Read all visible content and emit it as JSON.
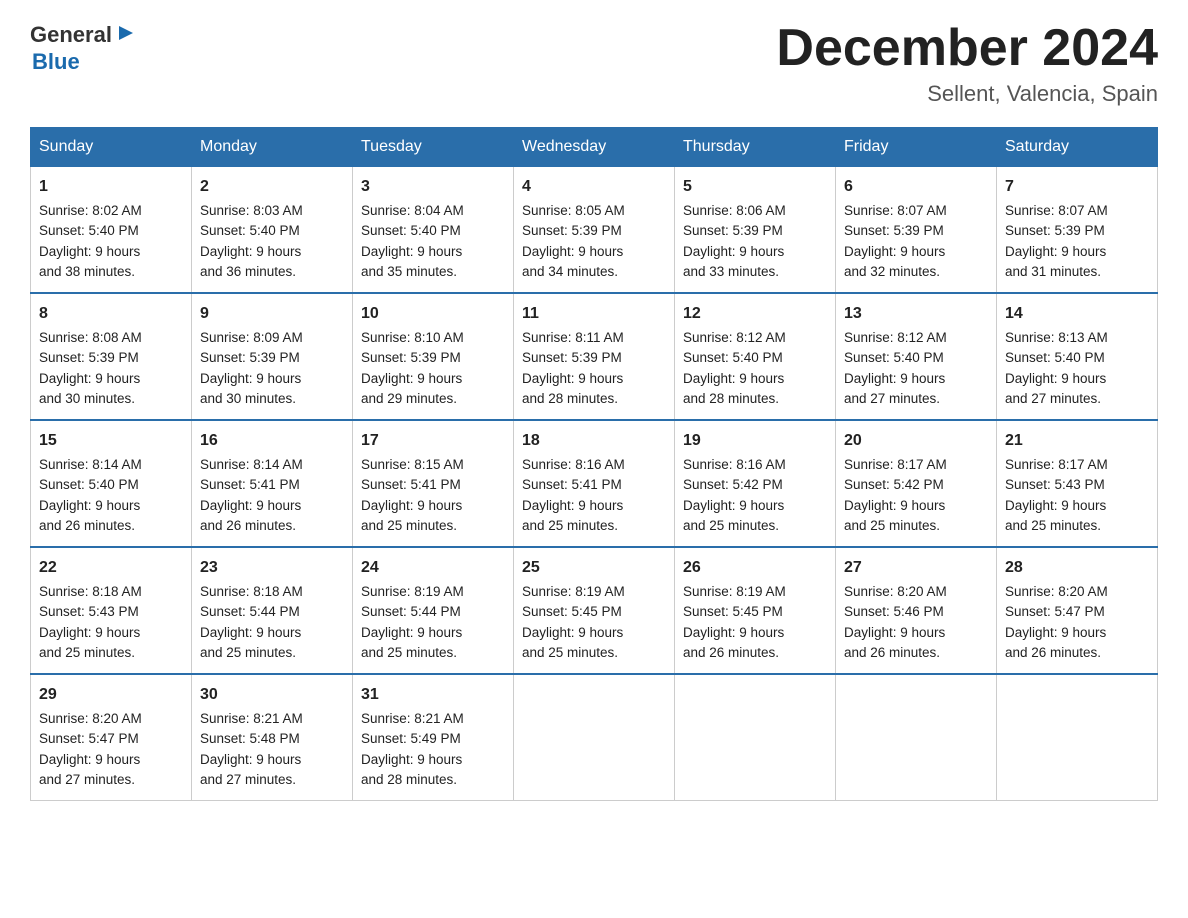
{
  "logo": {
    "text_general": "General",
    "text_blue": "Blue"
  },
  "title": "December 2024",
  "location": "Sellent, Valencia, Spain",
  "days_of_week": [
    "Sunday",
    "Monday",
    "Tuesday",
    "Wednesday",
    "Thursday",
    "Friday",
    "Saturday"
  ],
  "weeks": [
    [
      {
        "day": "1",
        "sunrise": "8:02 AM",
        "sunset": "5:40 PM",
        "daylight": "9 hours and 38 minutes."
      },
      {
        "day": "2",
        "sunrise": "8:03 AM",
        "sunset": "5:40 PM",
        "daylight": "9 hours and 36 minutes."
      },
      {
        "day": "3",
        "sunrise": "8:04 AM",
        "sunset": "5:40 PM",
        "daylight": "9 hours and 35 minutes."
      },
      {
        "day": "4",
        "sunrise": "8:05 AM",
        "sunset": "5:39 PM",
        "daylight": "9 hours and 34 minutes."
      },
      {
        "day": "5",
        "sunrise": "8:06 AM",
        "sunset": "5:39 PM",
        "daylight": "9 hours and 33 minutes."
      },
      {
        "day": "6",
        "sunrise": "8:07 AM",
        "sunset": "5:39 PM",
        "daylight": "9 hours and 32 minutes."
      },
      {
        "day": "7",
        "sunrise": "8:07 AM",
        "sunset": "5:39 PM",
        "daylight": "9 hours and 31 minutes."
      }
    ],
    [
      {
        "day": "8",
        "sunrise": "8:08 AM",
        "sunset": "5:39 PM",
        "daylight": "9 hours and 30 minutes."
      },
      {
        "day": "9",
        "sunrise": "8:09 AM",
        "sunset": "5:39 PM",
        "daylight": "9 hours and 30 minutes."
      },
      {
        "day": "10",
        "sunrise": "8:10 AM",
        "sunset": "5:39 PM",
        "daylight": "9 hours and 29 minutes."
      },
      {
        "day": "11",
        "sunrise": "8:11 AM",
        "sunset": "5:39 PM",
        "daylight": "9 hours and 28 minutes."
      },
      {
        "day": "12",
        "sunrise": "8:12 AM",
        "sunset": "5:40 PM",
        "daylight": "9 hours and 28 minutes."
      },
      {
        "day": "13",
        "sunrise": "8:12 AM",
        "sunset": "5:40 PM",
        "daylight": "9 hours and 27 minutes."
      },
      {
        "day": "14",
        "sunrise": "8:13 AM",
        "sunset": "5:40 PM",
        "daylight": "9 hours and 27 minutes."
      }
    ],
    [
      {
        "day": "15",
        "sunrise": "8:14 AM",
        "sunset": "5:40 PM",
        "daylight": "9 hours and 26 minutes."
      },
      {
        "day": "16",
        "sunrise": "8:14 AM",
        "sunset": "5:41 PM",
        "daylight": "9 hours and 26 minutes."
      },
      {
        "day": "17",
        "sunrise": "8:15 AM",
        "sunset": "5:41 PM",
        "daylight": "9 hours and 25 minutes."
      },
      {
        "day": "18",
        "sunrise": "8:16 AM",
        "sunset": "5:41 PM",
        "daylight": "9 hours and 25 minutes."
      },
      {
        "day": "19",
        "sunrise": "8:16 AM",
        "sunset": "5:42 PM",
        "daylight": "9 hours and 25 minutes."
      },
      {
        "day": "20",
        "sunrise": "8:17 AM",
        "sunset": "5:42 PM",
        "daylight": "9 hours and 25 minutes."
      },
      {
        "day": "21",
        "sunrise": "8:17 AM",
        "sunset": "5:43 PM",
        "daylight": "9 hours and 25 minutes."
      }
    ],
    [
      {
        "day": "22",
        "sunrise": "8:18 AM",
        "sunset": "5:43 PM",
        "daylight": "9 hours and 25 minutes."
      },
      {
        "day": "23",
        "sunrise": "8:18 AM",
        "sunset": "5:44 PM",
        "daylight": "9 hours and 25 minutes."
      },
      {
        "day": "24",
        "sunrise": "8:19 AM",
        "sunset": "5:44 PM",
        "daylight": "9 hours and 25 minutes."
      },
      {
        "day": "25",
        "sunrise": "8:19 AM",
        "sunset": "5:45 PM",
        "daylight": "9 hours and 25 minutes."
      },
      {
        "day": "26",
        "sunrise": "8:19 AM",
        "sunset": "5:45 PM",
        "daylight": "9 hours and 26 minutes."
      },
      {
        "day": "27",
        "sunrise": "8:20 AM",
        "sunset": "5:46 PM",
        "daylight": "9 hours and 26 minutes."
      },
      {
        "day": "28",
        "sunrise": "8:20 AM",
        "sunset": "5:47 PM",
        "daylight": "9 hours and 26 minutes."
      }
    ],
    [
      {
        "day": "29",
        "sunrise": "8:20 AM",
        "sunset": "5:47 PM",
        "daylight": "9 hours and 27 minutes."
      },
      {
        "day": "30",
        "sunrise": "8:21 AM",
        "sunset": "5:48 PM",
        "daylight": "9 hours and 27 minutes."
      },
      {
        "day": "31",
        "sunrise": "8:21 AM",
        "sunset": "5:49 PM",
        "daylight": "9 hours and 28 minutes."
      },
      null,
      null,
      null,
      null
    ]
  ],
  "labels": {
    "sunrise": "Sunrise:",
    "sunset": "Sunset:",
    "daylight": "Daylight:"
  }
}
